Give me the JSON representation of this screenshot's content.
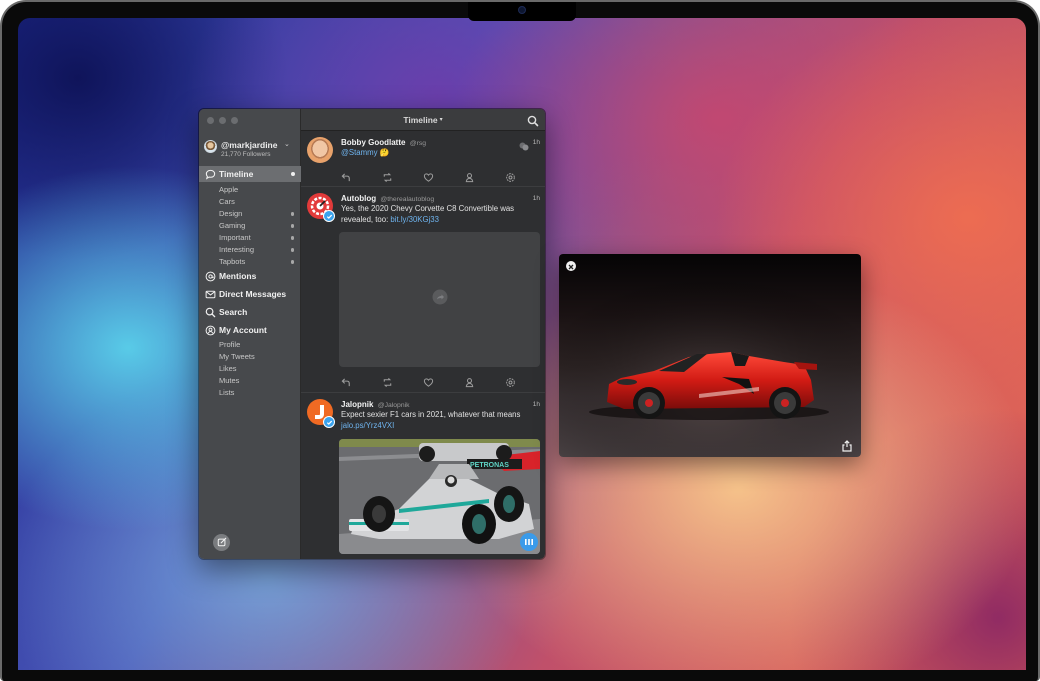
{
  "window": {
    "title": "Timeline",
    "title_chevron": "⌄"
  },
  "sidebar": {
    "account": {
      "handle": "@markjardine",
      "chevron": "⌄",
      "followers": "21,770 Followers"
    },
    "items": [
      {
        "label": "Timeline",
        "icon": "speech-bubble-icon",
        "active": true,
        "dot": true
      },
      {
        "label": "Mentions",
        "icon": "at-sign-icon"
      },
      {
        "label": "Direct Messages",
        "icon": "envelope-icon"
      },
      {
        "label": "Search",
        "icon": "search-icon"
      },
      {
        "label": "My Account",
        "icon": "account-icon"
      }
    ],
    "timeline_lists": [
      {
        "label": "Apple",
        "dot": false
      },
      {
        "label": "Cars",
        "dot": false
      },
      {
        "label": "Design",
        "dot": true
      },
      {
        "label": "Gaming",
        "dot": true
      },
      {
        "label": "Important",
        "dot": true
      },
      {
        "label": "Interesting",
        "dot": true
      },
      {
        "label": "Tapbots",
        "dot": true
      }
    ],
    "account_links": [
      {
        "label": "Profile"
      },
      {
        "label": "My Tweets"
      },
      {
        "label": "Likes"
      },
      {
        "label": "Mutes"
      },
      {
        "label": "Lists"
      }
    ],
    "compose_icon": "compose-icon"
  },
  "tweets": [
    {
      "name": "Bobby Goodlatte",
      "handle": "@rsg",
      "time": "1h",
      "mention": "@Stammy",
      "emoji": "🤔",
      "has_conversation_icon": true
    },
    {
      "name": "Autoblog",
      "handle": "@therealautoblog",
      "time": "1h",
      "text": "Yes, the 2020 Chevy Corvette C8 Convertible was revealed, too: ",
      "link": "bit.ly/30KGj33",
      "verified": true,
      "media": "link-preview-placeholder"
    },
    {
      "name": "Jalopnik",
      "handle": "@Jalopnik",
      "time": "1h",
      "text": "Expect sexier F1 cars in 2021, whatever that means",
      "link": "jalo.ps/Yrz4VXI",
      "verified": true,
      "media": "f1-race-car-photo",
      "media_caption": "PETRONAS"
    }
  ],
  "tweet_actions": [
    "reply-icon",
    "retweet-icon",
    "like-icon",
    "profile-icon",
    "settings-icon"
  ],
  "image_viewer": {
    "subject": "red-corvette-convertible",
    "close_icon": "close-icon",
    "share_icon": "share-icon"
  },
  "colors": {
    "accent": "#3aa3ee",
    "link": "#6fb4ef",
    "sidebar_bg": "#47494c",
    "timeline_bg": "#2e2f31"
  }
}
